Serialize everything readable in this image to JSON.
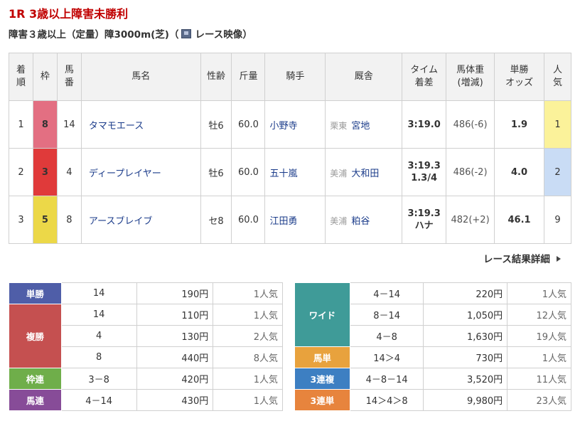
{
  "race": {
    "title": "1R 3歳以上障害未勝利",
    "conditions": "障害３歳以上（定量）障3000m(芝)（",
    "video_label": "レース映像",
    "close_paren": "）"
  },
  "results_headers": {
    "rank": [
      "着",
      "順"
    ],
    "waku": "枠",
    "umaban": [
      "馬",
      "番"
    ],
    "name": "馬名",
    "sex_age": "性齢",
    "weight": "斤量",
    "jockey": "騎手",
    "stable": "厩舎",
    "time": [
      "タイム",
      "着差"
    ],
    "body_weight": [
      "馬体重",
      "(増減)"
    ],
    "odds": [
      "単勝",
      "オッズ"
    ],
    "popularity": [
      "人",
      "気"
    ]
  },
  "results": [
    {
      "rank": "1",
      "waku": "8",
      "umaban": "14",
      "name": "タマモエース",
      "sex_age": "牡6",
      "weight": "60.0",
      "jockey": "小野寺",
      "region": "栗東",
      "trainer": "宮地",
      "time": "3:19.0",
      "margin": "",
      "body_weight": "486(-6)",
      "odds": "1.9",
      "popularity": "1"
    },
    {
      "rank": "2",
      "waku": "3",
      "umaban": "4",
      "name": "ディープレイヤー",
      "sex_age": "牡6",
      "weight": "60.0",
      "jockey": "五十嵐",
      "region": "美浦",
      "trainer": "大和田",
      "time": "3:19.3",
      "margin": "1.3/4",
      "body_weight": "486(-2)",
      "odds": "4.0",
      "popularity": "2"
    },
    {
      "rank": "3",
      "waku": "5",
      "umaban": "8",
      "name": "アースブレイブ",
      "sex_age": "セ8",
      "weight": "60.0",
      "jockey": "江田勇",
      "region": "美浦",
      "trainer": "粕谷",
      "time": "3:19.3",
      "margin": "ハナ",
      "body_weight": "482(+2)",
      "odds": "46.1",
      "popularity": "9"
    }
  ],
  "detail_link": "レース結果詳細",
  "payouts_left": {
    "tansho": {
      "label": "単勝",
      "rows": [
        {
          "combo": "14",
          "yen": "190円",
          "ninki": "1人気"
        }
      ]
    },
    "fukusho": {
      "label": "複勝",
      "rows": [
        {
          "combo": "14",
          "yen": "110円",
          "ninki": "1人気"
        },
        {
          "combo": "4",
          "yen": "130円",
          "ninki": "2人気"
        },
        {
          "combo": "8",
          "yen": "440円",
          "ninki": "8人気"
        }
      ]
    },
    "wakuren": {
      "label": "枠連",
      "rows": [
        {
          "combo": "3－8",
          "yen": "420円",
          "ninki": "1人気"
        }
      ]
    },
    "umaren": {
      "label": "馬連",
      "rows": [
        {
          "combo": "4－14",
          "yen": "430円",
          "ninki": "1人気"
        }
      ]
    }
  },
  "payouts_right": {
    "wide": {
      "label": "ワイド",
      "rows": [
        {
          "combo": "4－14",
          "yen": "220円",
          "ninki": "1人気"
        },
        {
          "combo": "8－14",
          "yen": "1,050円",
          "ninki": "12人気"
        },
        {
          "combo": "4－8",
          "yen": "1,630円",
          "ninki": "19人気"
        }
      ]
    },
    "umatan": {
      "label": "馬単",
      "rows": [
        {
          "combo": "14＞4",
          "yen": "730円",
          "ninki": "1人気"
        }
      ]
    },
    "sanrenpuku": {
      "label": "3連複",
      "rows": [
        {
          "combo": "4－8－14",
          "yen": "3,520円",
          "ninki": "11人気"
        }
      ]
    },
    "sanrentan": {
      "label": "3連単",
      "rows": [
        {
          "combo": "14＞4＞8",
          "yen": "9,980円",
          "ninki": "23人気"
        }
      ]
    }
  },
  "colors": {
    "title": "#c00000",
    "waku8": "#e36f82",
    "waku3": "#e03a3a",
    "waku5": "#ecd848",
    "pop1": "#fbf29a",
    "pop2": "#c9dcf5",
    "tansho": "#4f5ea8",
    "fukusho": "#c55050",
    "wakuren": "#6fae4a",
    "umaren": "#874c98",
    "wide": "#3f9b98",
    "umatan": "#e8a23d",
    "sanrenpuku": "#3d7fc2",
    "sanrentan": "#e7843d"
  },
  "icons": {
    "video": "video-icon",
    "detail_arrow": "triangle-right-icon"
  }
}
